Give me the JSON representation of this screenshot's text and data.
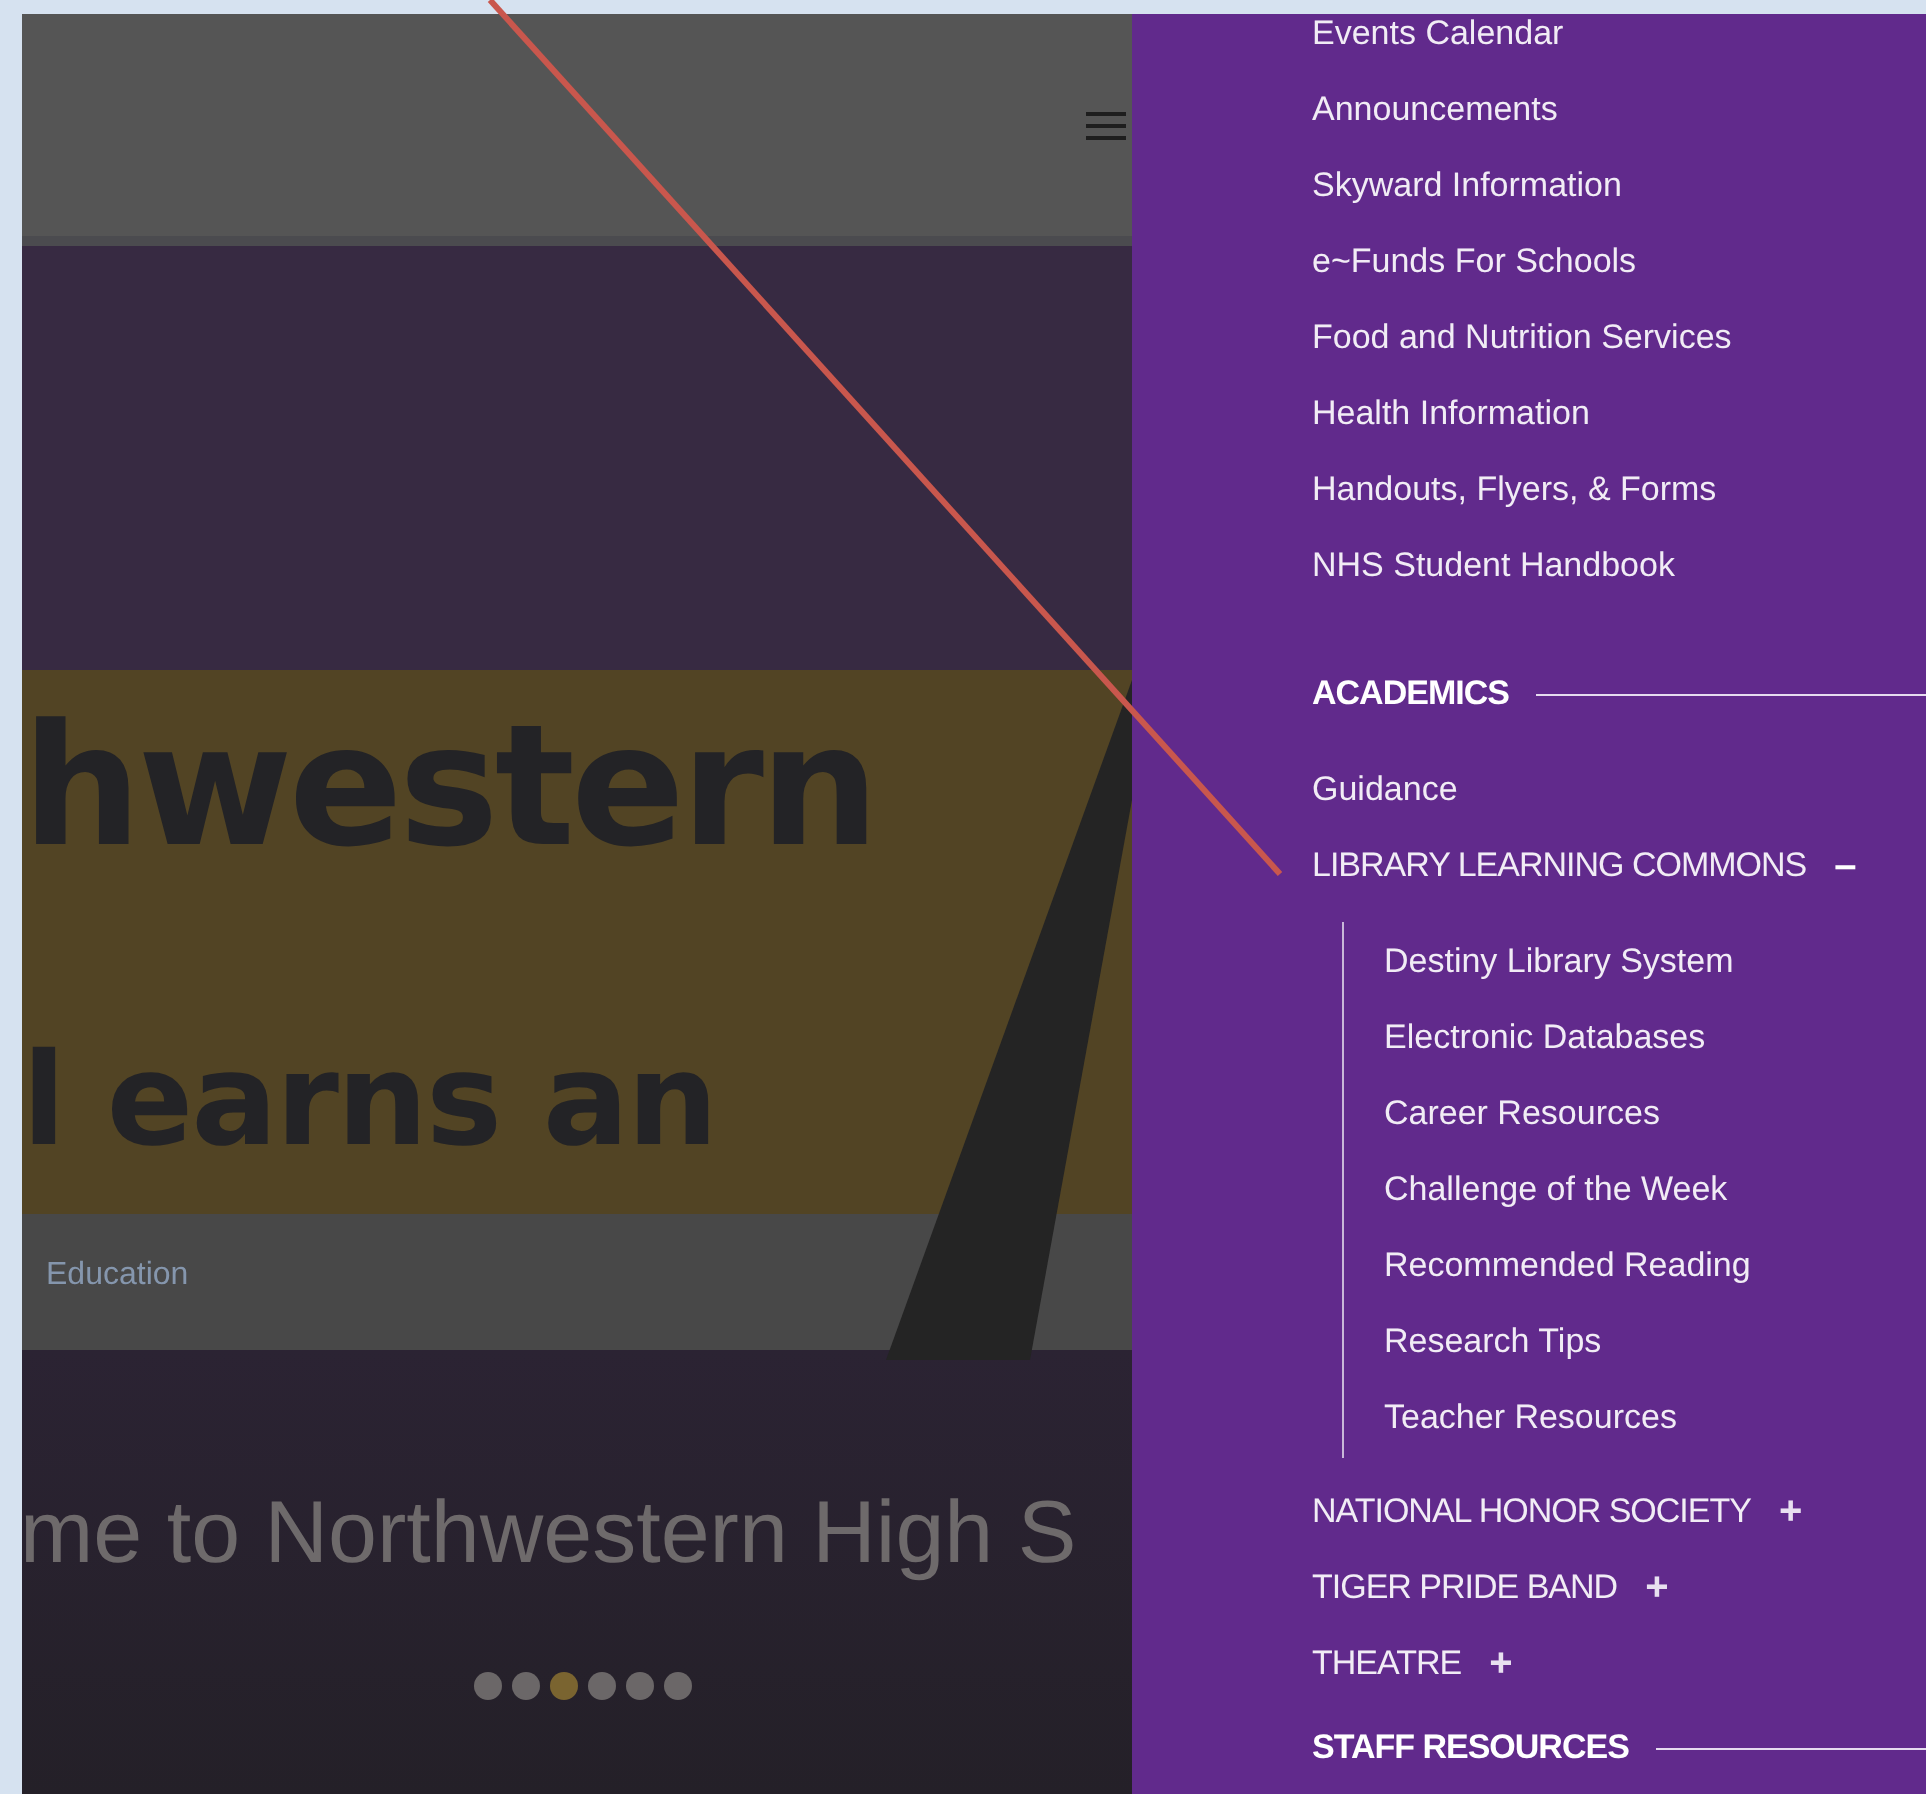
{
  "banner": {
    "lines": [
      "hwestern",
      "l earns an"
    ],
    "caption": "Education"
  },
  "welcome": "me to Northwestern High S",
  "slides": [
    {
      "selected": false
    },
    {
      "selected": false
    },
    {
      "selected": true
    },
    {
      "selected": false
    },
    {
      "selected": false
    },
    {
      "selected": false
    }
  ],
  "menu": {
    "top_links": [
      "Events Calendar",
      "Announcements",
      "Skyward Information",
      "e~Funds For Schools",
      "Food and Nutrition Services",
      "Health Information",
      "Handouts, Flyers, & Forms",
      "NHS Student Handbook"
    ],
    "sections": [
      {
        "title": "ACADEMICS",
        "items": [
          {
            "kind": "link",
            "label": "Guidance"
          },
          {
            "kind": "group",
            "label": "LIBRARY LEARNING COMMONS",
            "toggle": "–",
            "expanded": true,
            "children": [
              "Destiny Library System",
              "Electronic Databases",
              "Career Resources",
              "Challenge of the Week",
              "Recommended Reading",
              "Research Tips",
              "Teacher Resources"
            ]
          },
          {
            "kind": "group",
            "label": "NATIONAL HONOR SOCIETY",
            "toggle": "+",
            "expanded": false
          },
          {
            "kind": "group",
            "label": "TIGER PRIDE BAND",
            "toggle": "+",
            "expanded": false
          },
          {
            "kind": "group",
            "label": "THEATRE",
            "toggle": "+",
            "expanded": false
          }
        ]
      },
      {
        "title": "STAFF RESOURCES"
      }
    ]
  }
}
